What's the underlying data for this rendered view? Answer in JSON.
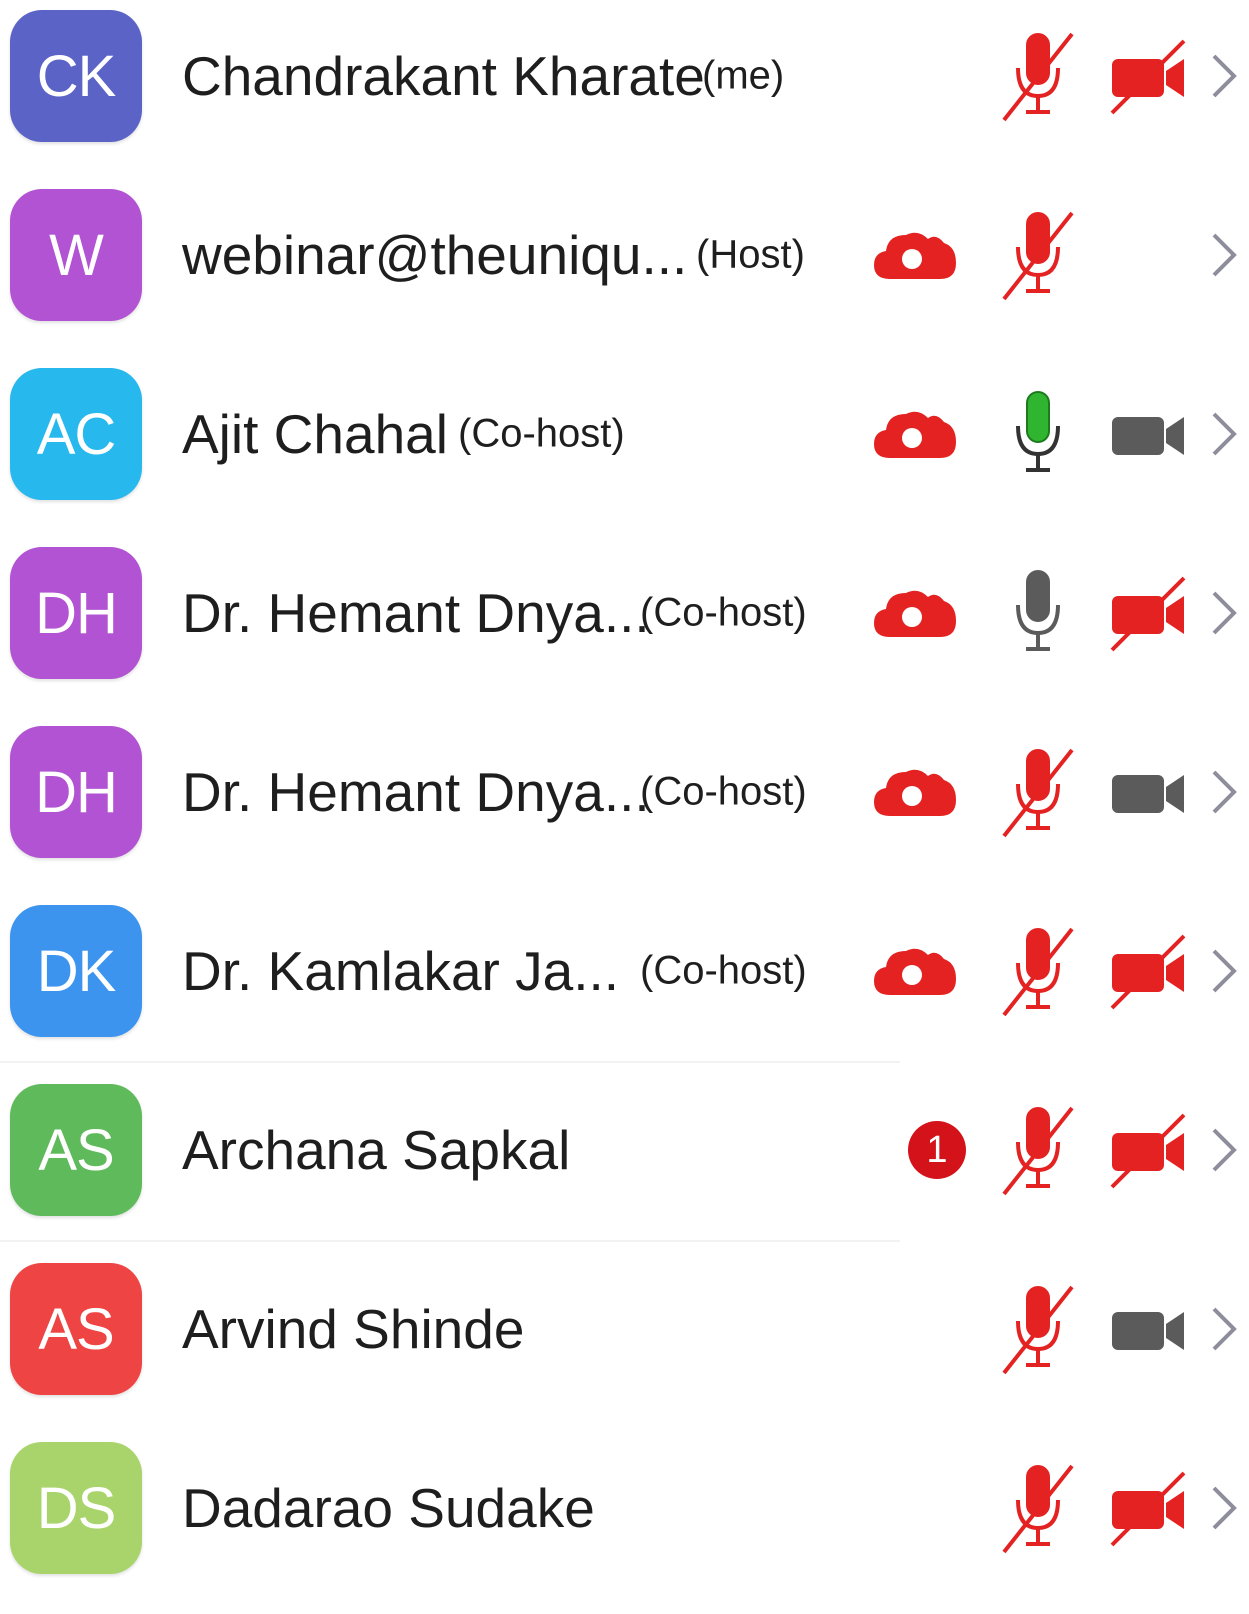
{
  "participants": [
    {
      "initials": "CK",
      "name": "Chandrakant Kharate",
      "role": "(me)",
      "avatar_color": "#5b63c7",
      "cloud": false,
      "badge": "",
      "mic": "muted",
      "video": "off"
    },
    {
      "initials": "W",
      "name": "webinar@theuniqu...",
      "role": "(Host)",
      "avatar_color": "#b153d2",
      "cloud": true,
      "badge": "",
      "mic": "muted",
      "video": "none"
    },
    {
      "initials": "AC",
      "name": "Ajit Chahal",
      "role": "(Co-host)",
      "avatar_color": "#27b8ee",
      "cloud": true,
      "badge": "",
      "mic": "active",
      "video": "on"
    },
    {
      "initials": "DH",
      "name": "Dr. Hemant Dnya...",
      "role": "(Co-host)",
      "avatar_color": "#b153d2",
      "cloud": true,
      "badge": "",
      "mic": "on",
      "video": "off"
    },
    {
      "initials": "DH",
      "name": "Dr. Hemant Dnya...",
      "role": "(Co-host)",
      "avatar_color": "#b153d2",
      "cloud": true,
      "badge": "",
      "mic": "muted",
      "video": "on"
    },
    {
      "initials": "DK",
      "name": "Dr. Kamlakar Ja...",
      "role": "(Co-host)",
      "avatar_color": "#3c94ef",
      "cloud": true,
      "badge": "",
      "mic": "muted",
      "video": "off"
    },
    {
      "initials": "AS",
      "name": "Archana Sapkal",
      "role": "",
      "avatar_color": "#5fba5b",
      "cloud": false,
      "badge": "1",
      "mic": "muted",
      "video": "off"
    },
    {
      "initials": "AS",
      "name": "Arvind Shinde",
      "role": "",
      "avatar_color": "#ee4444",
      "cloud": false,
      "badge": "",
      "mic": "muted",
      "video": "on"
    },
    {
      "initials": "DS",
      "name": "Dadarao Sudake",
      "role": "",
      "avatar_color": "#a9d46b",
      "cloud": false,
      "badge": "",
      "mic": "muted",
      "video": "off"
    }
  ],
  "colors": {
    "muted_red": "#e42222",
    "active_green": "#2fb52f",
    "neutral_gray": "#5b5b5b",
    "chevron": "#8d8d9c"
  }
}
